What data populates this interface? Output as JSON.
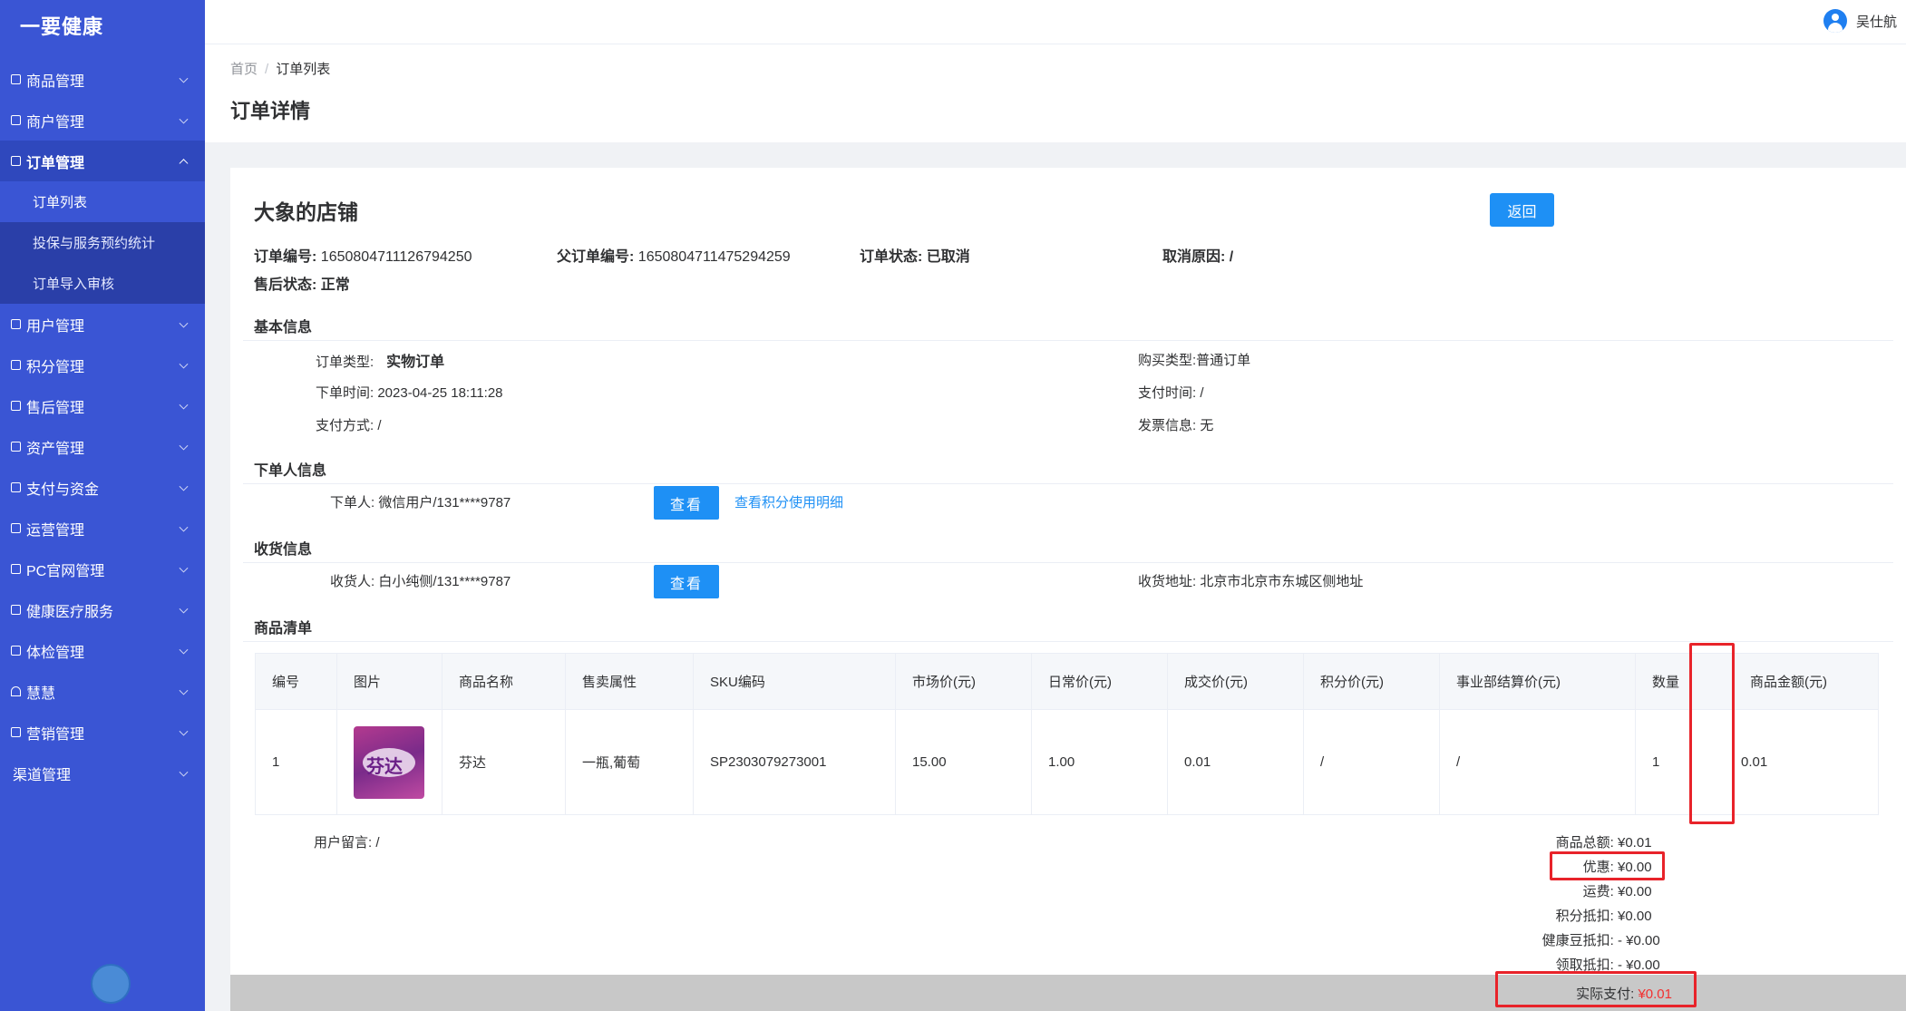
{
  "app": {
    "logo": "一要健康"
  },
  "sidebar": {
    "items": [
      {
        "label": "商品管理"
      },
      {
        "label": "商户管理"
      },
      {
        "label": "订单管理"
      },
      {
        "label": "用户管理"
      },
      {
        "label": "积分管理"
      },
      {
        "label": "售后管理"
      },
      {
        "label": "资产管理"
      },
      {
        "label": "支付与资金"
      },
      {
        "label": "运营管理"
      },
      {
        "label": "PC官网管理"
      },
      {
        "label": "健康医疗服务"
      },
      {
        "label": "体检管理"
      },
      {
        "label": "慧慧"
      },
      {
        "label": "营销管理"
      },
      {
        "label": "渠道管理"
      }
    ],
    "order_sub": [
      {
        "label": "订单列表"
      },
      {
        "label": "投保与服务预约统计"
      },
      {
        "label": "订单导入审核"
      }
    ]
  },
  "header": {
    "username": "吴仕航"
  },
  "breadcrumb": {
    "home": "首页",
    "separator": "/",
    "current": "订单列表"
  },
  "page": {
    "title": "订单详情"
  },
  "order": {
    "shop_name": "大象的店铺",
    "back_label": "返回",
    "order_no_label": "订单编号:",
    "order_no": "1650804711126794250",
    "parent_no_label": "父订单编号:",
    "parent_no": "1650804711475294259",
    "status_label": "订单状态:",
    "status": "已取消",
    "cancel_reason_label": "取消原因:",
    "cancel_reason": "/",
    "after_sale_label": "售后状态:",
    "after_sale": "正常"
  },
  "basic": {
    "title": "基本信息",
    "order_type_label": "订单类型:",
    "order_type": "实物订单",
    "purchase_type_label": "购买类型:",
    "purchase_type": "普通订单",
    "order_time_label": "下单时间:",
    "order_time": "2023-04-25 18:11:28",
    "pay_time_label": "支付时间:",
    "pay_time": "/",
    "pay_method_label": "支付方式:",
    "pay_method": "/",
    "invoice_label": "发票信息:",
    "invoice": "无"
  },
  "buyer": {
    "title": "下单人信息",
    "label": "下单人:",
    "value": "微信用户/131****9787",
    "view_label": "查看",
    "points_link": "查看积分使用明细"
  },
  "receiver": {
    "title": "收货信息",
    "label": "收货人:",
    "value": "白小纯侧/131****9787",
    "view_label": "查看",
    "address_label": "收货地址:",
    "address": "北京市北京市东城区侧地址"
  },
  "goods": {
    "title": "商品清单",
    "columns": [
      "编号",
      "图片",
      "商品名称",
      "售卖属性",
      "SKU编码",
      "市场价(元)",
      "日常价(元)",
      "成交价(元)",
      "积分价(元)",
      "事业部结算价(元)",
      "数量",
      "商品金额(元)"
    ],
    "rows": [
      {
        "no": "1",
        "image_text": "芬达",
        "name": "芬达",
        "attr": "一瓶,葡萄",
        "sku": "SP2303079273001",
        "market": "15.00",
        "daily": "1.00",
        "deal": "0.01",
        "points": "/",
        "settle": "/",
        "qty": "1",
        "amount": "0.01"
      }
    ]
  },
  "message": {
    "label": "用户留言:",
    "value": "/"
  },
  "summary": {
    "goods_total_label": "商品总额:",
    "goods_total": "¥0.01",
    "discount_label": "优惠:",
    "discount": "¥0.00",
    "shipping_label": "运费:",
    "shipping": "¥0.00",
    "points_deduct_label": "积分抵扣:",
    "points_deduct": "¥0.00",
    "bean_deduct_label": "健康豆抵扣:",
    "bean_deduct": "- ¥0.00",
    "claim_deduct_label": "领取抵扣:",
    "claim_deduct": "- ¥0.00",
    "actual_label": "实际支付:",
    "actual": "¥0.01"
  },
  "colors": {
    "sidebar": "#3a55d4",
    "primary": "#1e90f5",
    "highlight": "#e8232a",
    "price": "#f23030"
  }
}
